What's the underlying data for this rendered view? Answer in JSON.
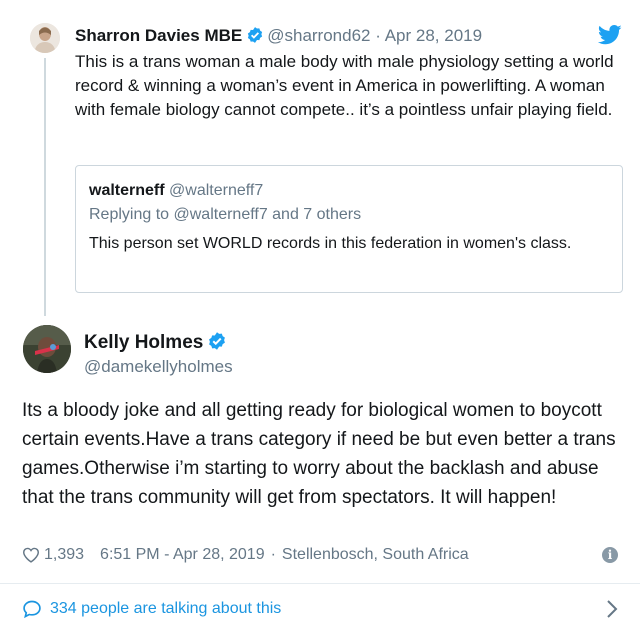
{
  "parent_tweet": {
    "name": "Sharron Davies MBE",
    "handle": "@sharrond62",
    "separator": "·",
    "date": "Apr 28, 2019",
    "text": "This is a trans woman a male body with male physiology setting a world record & winning a woman’s event in America in powerlifting. A woman with female biology cannot compete.. it’s a pointless unfair playing field.",
    "quoted": {
      "name": "walterneff",
      "handle": "@walterneff7",
      "replying_to": "Replying to @walterneff7 and 7 others",
      "text": "This person set WORLD records in this federation in women's class."
    }
  },
  "main_tweet": {
    "name": "Kelly Holmes",
    "handle": "@damekellyholmes",
    "text": "Its a bloody joke and all getting ready for biological women to boycott certain events.Have a trans category if need be but even better a trans games.Otherwise i’m starting to worry about the backlash and abuse that the trans community will get from spectators. It will happen!",
    "likes": "1,393",
    "time": "6:51 PM - Apr 28, 2019",
    "separator": "·",
    "location": "Stellenbosch, South Africa"
  },
  "footer": {
    "talking_label": "334 people are talking about this"
  },
  "colors": {
    "link_blue": "#1b95e0",
    "twitter_blue": "#1da1f2",
    "muted": "#657786",
    "border": "#ccd6dd"
  },
  "icons": {
    "verified": "verified-badge-icon",
    "bird": "twitter-bird-icon",
    "heart": "heart-icon",
    "info": "info-icon",
    "conversation": "speech-bubble-icon",
    "chevron": "chevron-right-icon"
  }
}
